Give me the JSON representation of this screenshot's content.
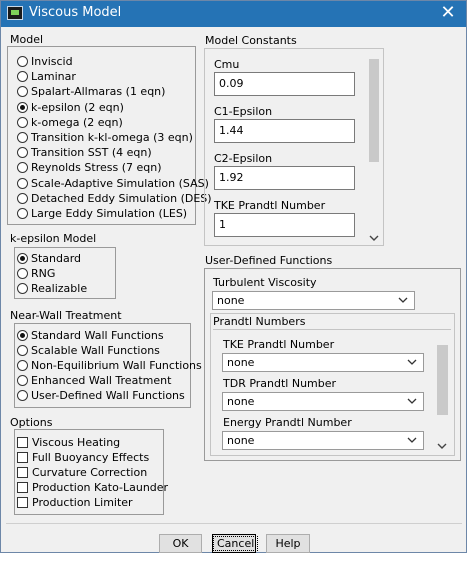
{
  "window": {
    "title": "Viscous Model",
    "close": "✕"
  },
  "model": {
    "label": "Model",
    "items": [
      {
        "label": "Inviscid",
        "selected": false
      },
      {
        "label": "Laminar",
        "selected": false
      },
      {
        "label": "Spalart-Allmaras (1 eqn)",
        "selected": false
      },
      {
        "label": "k-epsilon (2 eqn)",
        "selected": true
      },
      {
        "label": "k-omega (2 eqn)",
        "selected": false
      },
      {
        "label": "Transition k-kl-omega (3 eqn)",
        "selected": false
      },
      {
        "label": "Transition SST (4 eqn)",
        "selected": false
      },
      {
        "label": "Reynolds Stress (7 eqn)",
        "selected": false
      },
      {
        "label": "Scale-Adaptive Simulation (SAS)",
        "selected": false
      },
      {
        "label": "Detached Eddy Simulation (DES)",
        "selected": false
      },
      {
        "label": "Large Eddy Simulation (LES)",
        "selected": false
      }
    ]
  },
  "ke_model": {
    "label": "k-epsilon Model",
    "items": [
      {
        "label": "Standard",
        "selected": true
      },
      {
        "label": "RNG",
        "selected": false
      },
      {
        "label": "Realizable",
        "selected": false
      }
    ]
  },
  "near_wall": {
    "label": "Near-Wall Treatment",
    "items": [
      {
        "label": "Standard Wall Functions",
        "selected": true
      },
      {
        "label": "Scalable Wall Functions",
        "selected": false
      },
      {
        "label": "Non-Equilibrium Wall Functions",
        "selected": false
      },
      {
        "label": "Enhanced Wall Treatment",
        "selected": false
      },
      {
        "label": "User-Defined Wall Functions",
        "selected": false
      }
    ]
  },
  "options": {
    "label": "Options",
    "items": [
      {
        "label": "Viscous Heating",
        "checked": false
      },
      {
        "label": "Full Buoyancy Effects",
        "checked": false
      },
      {
        "label": "Curvature Correction",
        "checked": false
      },
      {
        "label": "Production Kato-Launder",
        "checked": false
      },
      {
        "label": "Production Limiter",
        "checked": false
      }
    ]
  },
  "constants": {
    "label": "Model Constants",
    "fields": [
      {
        "label": "Cmu",
        "value": "0.09"
      },
      {
        "label": "C1-Epsilon",
        "value": "1.44"
      },
      {
        "label": "C2-Epsilon",
        "value": "1.92"
      },
      {
        "label": "TKE Prandtl Number",
        "value": "1"
      }
    ]
  },
  "udf": {
    "label": "User-Defined Functions",
    "turb_visc_label": "Turbulent Viscosity",
    "turb_visc_value": "none",
    "prandtl_label": "Prandtl Numbers",
    "prandtl": [
      {
        "label": "TKE Prandtl Number",
        "value": "none"
      },
      {
        "label": "TDR Prandtl Number",
        "value": "none"
      },
      {
        "label": "Energy Prandtl Number",
        "value": "none"
      }
    ]
  },
  "buttons": {
    "ok": "OK",
    "cancel": "Cancel",
    "help": "Help"
  }
}
